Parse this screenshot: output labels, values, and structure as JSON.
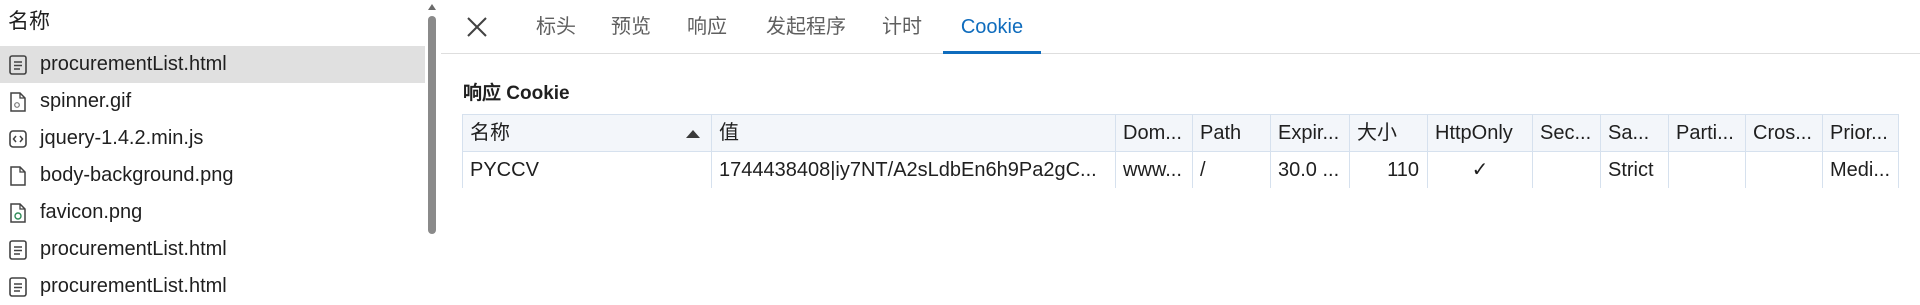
{
  "file_list": {
    "header": "名称",
    "items": [
      {
        "name": "procurementList.html",
        "icon": "document-icon",
        "selected": true
      },
      {
        "name": "spinner.gif",
        "icon": "image-file-icon",
        "selected": false
      },
      {
        "name": "jquery-1.4.2.min.js",
        "icon": "script-file-icon",
        "selected": false
      },
      {
        "name": "body-background.png",
        "icon": "file-icon",
        "selected": false
      },
      {
        "name": "favicon.png",
        "icon": "image-file-icon",
        "selected": false
      },
      {
        "name": "procurementList.html",
        "icon": "document-icon",
        "selected": false
      },
      {
        "name": "procurementList.html",
        "icon": "document-icon",
        "selected": false
      }
    ]
  },
  "tabs": [
    {
      "label": "标头",
      "active": false
    },
    {
      "label": "预览",
      "active": false
    },
    {
      "label": "响应",
      "active": false
    },
    {
      "label": "发起程序",
      "active": false
    },
    {
      "label": "计时",
      "active": false
    },
    {
      "label": "Cookie",
      "active": true
    }
  ],
  "section_title": "响应 Cookie",
  "cookie_table": {
    "columns": [
      "名称",
      "值",
      "Dom...",
      "Path",
      "Expir...",
      "大小",
      "HttpOnly",
      "Sec...",
      "Sa...",
      "Parti...",
      "Cros...",
      "Prior..."
    ],
    "sorted_column": "名称",
    "sort_direction": "ascending",
    "rows": [
      [
        "PYCCV",
        "1744438408|iy7NT/A2sLdbEn6h9Pa2gC...",
        "www...",
        "/",
        "30.0 ...",
        "110",
        "✓",
        "",
        "Strict",
        "",
        "",
        "Medi..."
      ]
    ]
  },
  "colors": {
    "accent": "#0f6cbd",
    "selected_row": "#e0e0e0",
    "table_border": "#d6e1ee",
    "table_header_bg": "#f3f6fa"
  }
}
